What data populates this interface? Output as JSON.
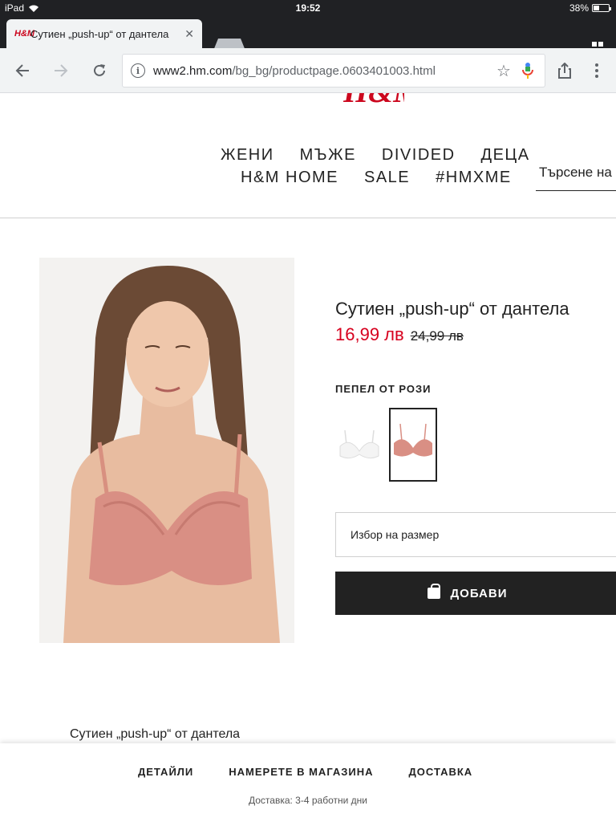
{
  "status_bar": {
    "device": "iPad",
    "time": "19:52",
    "battery": "38%",
    "battery_level": 0.38
  },
  "browser": {
    "tab": {
      "favicon_text": "H&M",
      "title": "Сутиен „push-up“ от дантела"
    },
    "url_domain": "www2.hm.com",
    "url_path": "/bg_bg/productpage.0603401003.html"
  },
  "site": {
    "logo_text": "H&M",
    "brand_color": "#cc071e",
    "nav_row1": [
      "ЖЕНИ",
      "МЪЖЕ",
      "DIVIDED",
      "ДЕЦА"
    ],
    "nav_row2": [
      "H&M HOME",
      "SALE",
      "#HMXME"
    ],
    "search_placeholder": "Търсене на продукти"
  },
  "product": {
    "title": "Сутиен „push-up“ от дантела",
    "price_now": "16,99 лв",
    "price_old": "24,99 лв",
    "price_color": "#d7001e",
    "color_label": "ПЕПЕЛ ОТ РОЗИ",
    "swatches": [
      "white",
      "rose"
    ],
    "size_select": "Избор на размер",
    "add_button": "ДОБАВИ"
  },
  "description": {
    "title": "Сутиен „push-up“ от дантела"
  },
  "bottom_bar": {
    "tabs": [
      "ДЕТАЙЛИ",
      "НАМЕРЕТЕ В МАГАЗИНА",
      "ДОСТАВКА"
    ],
    "delivery": "Доставка: 3-4 работни дни"
  }
}
